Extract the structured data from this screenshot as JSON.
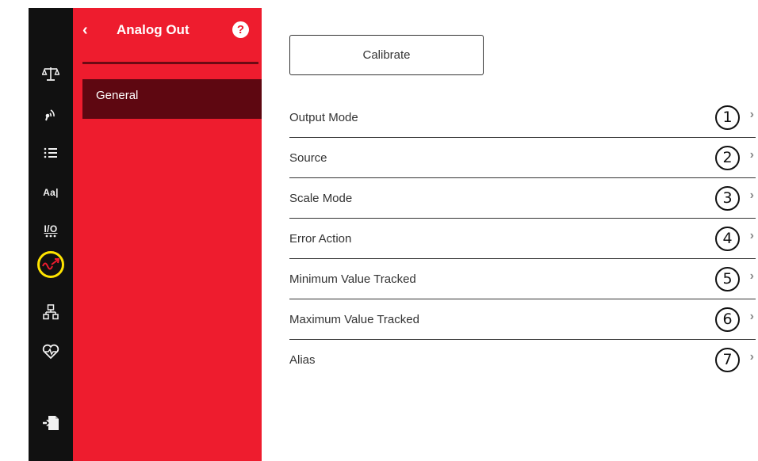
{
  "rail": {
    "icons": [
      {
        "name": "scale-icon"
      },
      {
        "name": "signal-icon"
      },
      {
        "name": "list-icon"
      },
      {
        "name": "text-format-icon",
        "text": "Aa|"
      },
      {
        "name": "io-icon",
        "text": "I/O"
      },
      {
        "name": "analog-out-icon"
      },
      {
        "name": "hierarchy-icon"
      },
      {
        "name": "heart-diagnostics-icon"
      },
      {
        "name": "export-icon"
      }
    ],
    "highlight_color": "#ffe400"
  },
  "panel": {
    "back_icon": "‹",
    "title": "Analog Out",
    "help_icon": "?",
    "items": [
      {
        "label": "General"
      }
    ],
    "color": "#ee1c2e",
    "selected_color": "#5e0711"
  },
  "main": {
    "calibrate_label": "Calibrate",
    "rows": [
      {
        "label": "Output Mode",
        "num": "1"
      },
      {
        "label": "Source",
        "num": "2"
      },
      {
        "label": "Scale Mode",
        "num": "3"
      },
      {
        "label": "Error Action",
        "num": "4"
      },
      {
        "label": "Minimum Value Tracked",
        "num": "5"
      },
      {
        "label": "Maximum Value Tracked",
        "num": "6"
      },
      {
        "label": "Alias",
        "num": "7"
      }
    ],
    "chevron": "›"
  }
}
